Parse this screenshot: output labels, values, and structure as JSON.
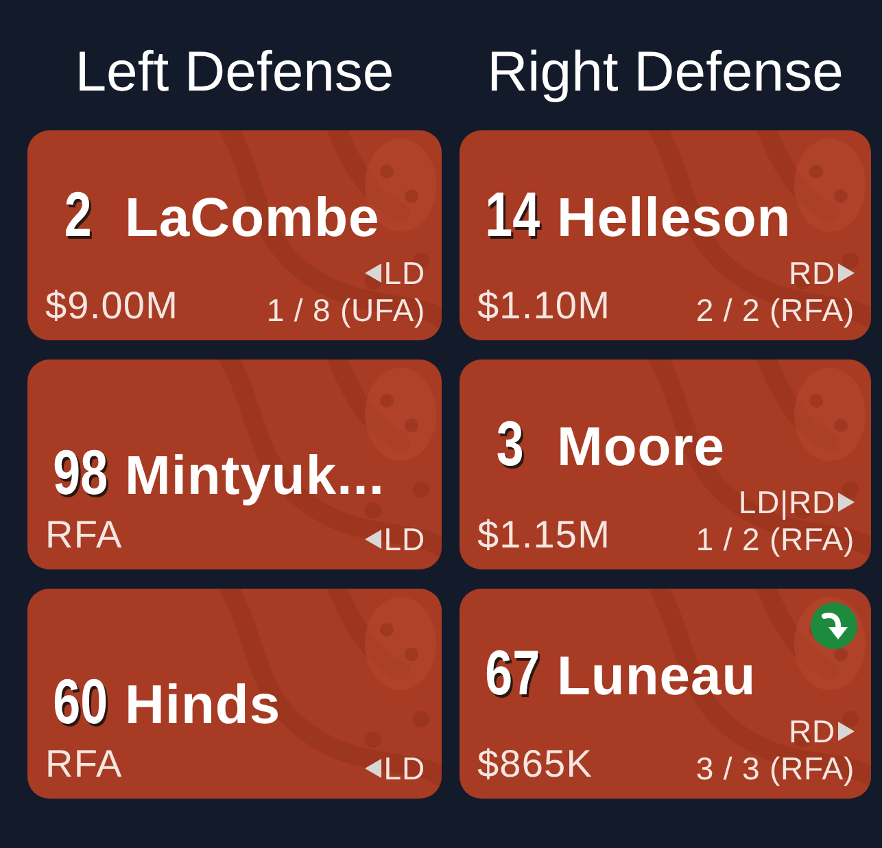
{
  "columns": [
    {
      "title": "Left Defense",
      "players": [
        {
          "kind": "left",
          "number": "2",
          "name": "LaCombe",
          "salary": "$9.00M",
          "position": "LD",
          "contract": "1 / 8 (UFA)",
          "flagged": false
        },
        {
          "kind": "left",
          "number": "98",
          "name": "Mintyuk...",
          "salary": "RFA",
          "position": "LD",
          "flagged": false
        },
        {
          "kind": "left",
          "number": "60",
          "name": "Hinds",
          "salary": "RFA",
          "position": "LD",
          "flagged": false
        }
      ]
    },
    {
      "title": "Right Defense",
      "players": [
        {
          "kind": "right",
          "number": "14",
          "name": "Helleson",
          "salary": "$1.10M",
          "position": "RD",
          "contract": "2 / 2 (RFA)",
          "flagged": false
        },
        {
          "kind": "right",
          "number": "3",
          "name": "Moore",
          "salary": "$1.15M",
          "position": "LD|RD",
          "contract": "1 / 2 (RFA)",
          "flagged": false
        },
        {
          "kind": "right",
          "number": "67",
          "name": "Luneau",
          "salary": "$865K",
          "position": "RD",
          "contract": "3 / 3 (RFA)",
          "flagged": true
        }
      ]
    }
  ]
}
